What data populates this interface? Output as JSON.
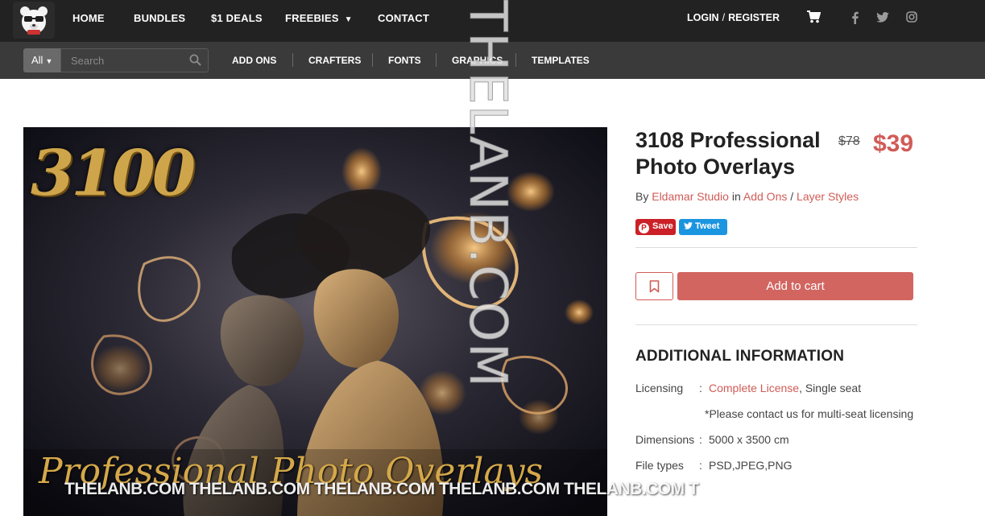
{
  "topnav": {
    "items": [
      "HOME",
      "BUNDLES",
      "$1 DEALS",
      "FREEBIES",
      "CONTACT"
    ],
    "login": "LOGIN",
    "separator": "/",
    "register": "REGISTER"
  },
  "subnav": {
    "all_label": "All",
    "search_placeholder": "Search",
    "items": [
      "ADD ONS",
      "CRAFTERS",
      "FONTS",
      "GRAPHICS",
      "TEMPLATES"
    ]
  },
  "product_image": {
    "headline_number": "3100",
    "headline_text": "Professional Photo Overlays",
    "strip_watermark": "THELANB.COM THELANB.COM THELANB.COM THELANB.COM THELANB.COM T",
    "vertical_watermark": "THELANB.COM"
  },
  "product": {
    "title": "3108 Professional Photo Overlays",
    "old_price": "$78",
    "price": "$39",
    "by_prefix": "By",
    "author": "Eldamar Studio",
    "in_word": "in",
    "category": "Add Ons",
    "cat_sep": "/",
    "subcategory": "Layer Styles",
    "save_label": "Save",
    "tweet_label": "Tweet",
    "add_to_cart": "Add to cart"
  },
  "additional_info": {
    "heading": "ADDITIONAL INFORMATION",
    "licensing_label": "Licensing",
    "licensing_link": "Complete License",
    "licensing_rest": ", Single seat",
    "licensing_note": "*Please contact us for multi-seat licensing",
    "dimensions_label": "Dimensions",
    "dimensions_value": "5000 x 3500 cm",
    "filetypes_label": "File types",
    "filetypes_value": "PSD,JPEG,PNG",
    "colon": ":"
  },
  "colors": {
    "accent": "#d05c57",
    "topbar": "#222222",
    "subbar": "#3a3a3a"
  },
  "icons": [
    "logo-bear-icon",
    "chevron-down-icon",
    "cart-icon",
    "facebook-icon",
    "twitter-icon",
    "instagram-icon",
    "search-icon",
    "bookmark-icon",
    "pinterest-icon",
    "twitter-bird-icon"
  ]
}
